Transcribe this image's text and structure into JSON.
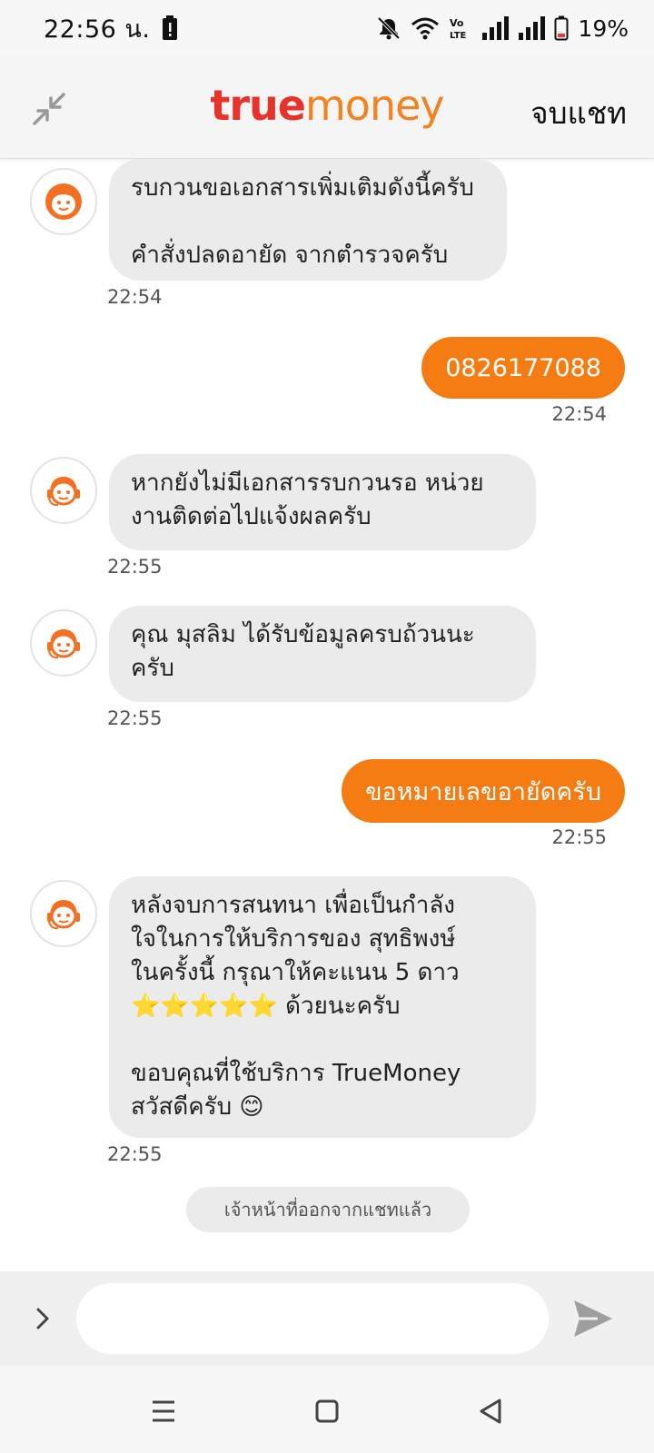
{
  "status_bar": {
    "time": "22:56 น.",
    "battery_percent": "19%",
    "icons": [
      "battery-alert-icon",
      "mute-icon",
      "wifi-icon",
      "volte-icon",
      "signal-icon",
      "signal-icon",
      "battery-icon"
    ]
  },
  "header": {
    "logo_part1": "true",
    "logo_part2": "money",
    "end_chat_label": "จบแชท"
  },
  "messages": [
    {
      "sender": "agent",
      "text": "รบกวนขอเอกสารเพิ่มเติมดังนี้ครับ\n\nคำสั่งปลดอายัด จากตำรวจครับ",
      "time": "22:54"
    },
    {
      "sender": "user",
      "text": "0826177088",
      "time": "22:54"
    },
    {
      "sender": "agent",
      "text": "หากยังไม่มีเอกสารรบกวนรอ หน่วย\nงานติดต่อไปแจ้งผลครับ",
      "time": "22:55"
    },
    {
      "sender": "agent",
      "text": "คุณ มุสลิม ได้รับข้อมูลครบถ้วนนะ\nครับ",
      "time": "22:55"
    },
    {
      "sender": "user",
      "text": "ขอหมายเลขอายัดครับ",
      "time": "22:55"
    },
    {
      "sender": "agent",
      "text": "หลังจบการสนทนา เพื่อเป็นกำลัง\nใจในการให้บริการของ สุทธิพงษ์\nในครั้งนี้ กรุณาให้คะแนน 5 ดาว\n⭐⭐⭐⭐⭐ ด้วยนะครับ\n\nขอบคุณที่ใช้บริการ TrueMoney\nสวัสดีครับ 😊",
      "time": "22:55"
    }
  ],
  "system_notice": "เจ้าหน้าที่ออกจากแชทแล้ว",
  "input": {
    "value": "",
    "placeholder": ""
  },
  "colors": {
    "brand_orange": "#f57c13",
    "logo_red": "#e8332b",
    "agent_bubble": "#ebebeb"
  }
}
